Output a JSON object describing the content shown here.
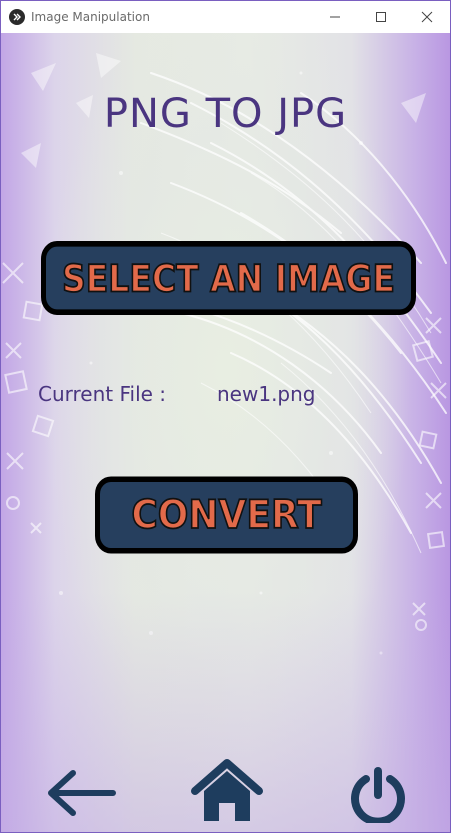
{
  "window": {
    "title": "Image Manipulation",
    "icons": [
      "kivy-icon",
      "minimize-icon",
      "maximize-icon",
      "close-icon"
    ]
  },
  "main": {
    "heading": "PNG TO JPG",
    "select_button_label": "SELECT AN IMAGE",
    "current_file_label": "Current File :",
    "current_file_value": "new1.png",
    "convert_button_label": "CONVERT"
  },
  "nav": {
    "icons": [
      "back-arrow-icon",
      "home-icon",
      "power-icon"
    ]
  },
  "colors": {
    "heading": "#4a3580",
    "button_bg": "#263f5e",
    "button_text": "#e26a4a",
    "button_border": "#000000",
    "nav_icon": "#1e3d5e"
  }
}
